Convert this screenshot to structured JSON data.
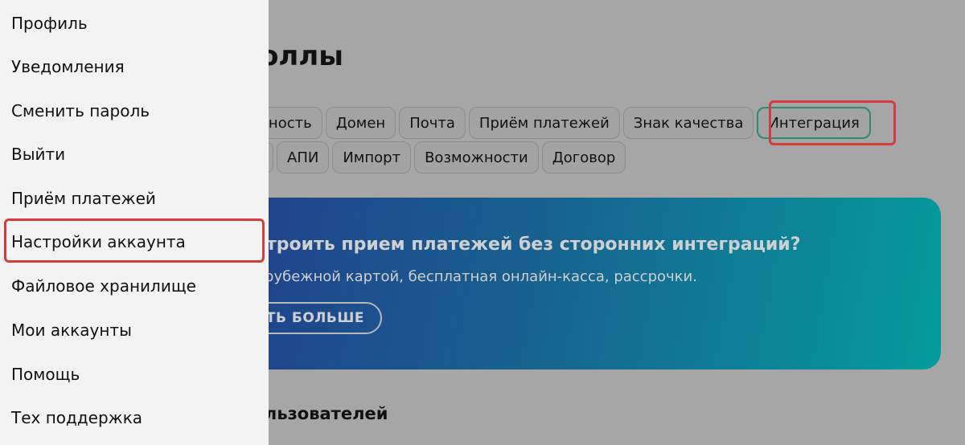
{
  "page": {
    "title": "коллы",
    "tabs_row1": [
      "асность",
      "Домен",
      "Почта",
      "Приём платежей",
      "Знак качества",
      "Интеграция"
    ],
    "tabs_row2": [
      "",
      "АПИ",
      "Импорт",
      "Возможности",
      "Договор"
    ],
    "active_tab": "Интеграция",
    "banner": {
      "title": "строить прием платежей без сторонних интеграций?",
      "text": "арубежной картой, бесплатная онлайн-касса, рассрочки.",
      "button_label": "ТЬ БОЛЬШЕ"
    },
    "section_title": "пользователей"
  },
  "menu": {
    "items": [
      "Профиль",
      "Уведомления",
      "Сменить пароль",
      "Выйти",
      "Приём платежей",
      "Настройки аккаунта",
      "Файловое хранилище",
      "Мои аккаунты",
      "Помощь",
      "Тех поддержка"
    ],
    "highlighted_item": "Настройки аккаунта"
  },
  "colors": {
    "highlight_border": "#d93a3a",
    "active_tab_border": "#2e8b6b",
    "overlay_bg": "#a6a6a6",
    "menu_bg": "#f3f3f3"
  }
}
